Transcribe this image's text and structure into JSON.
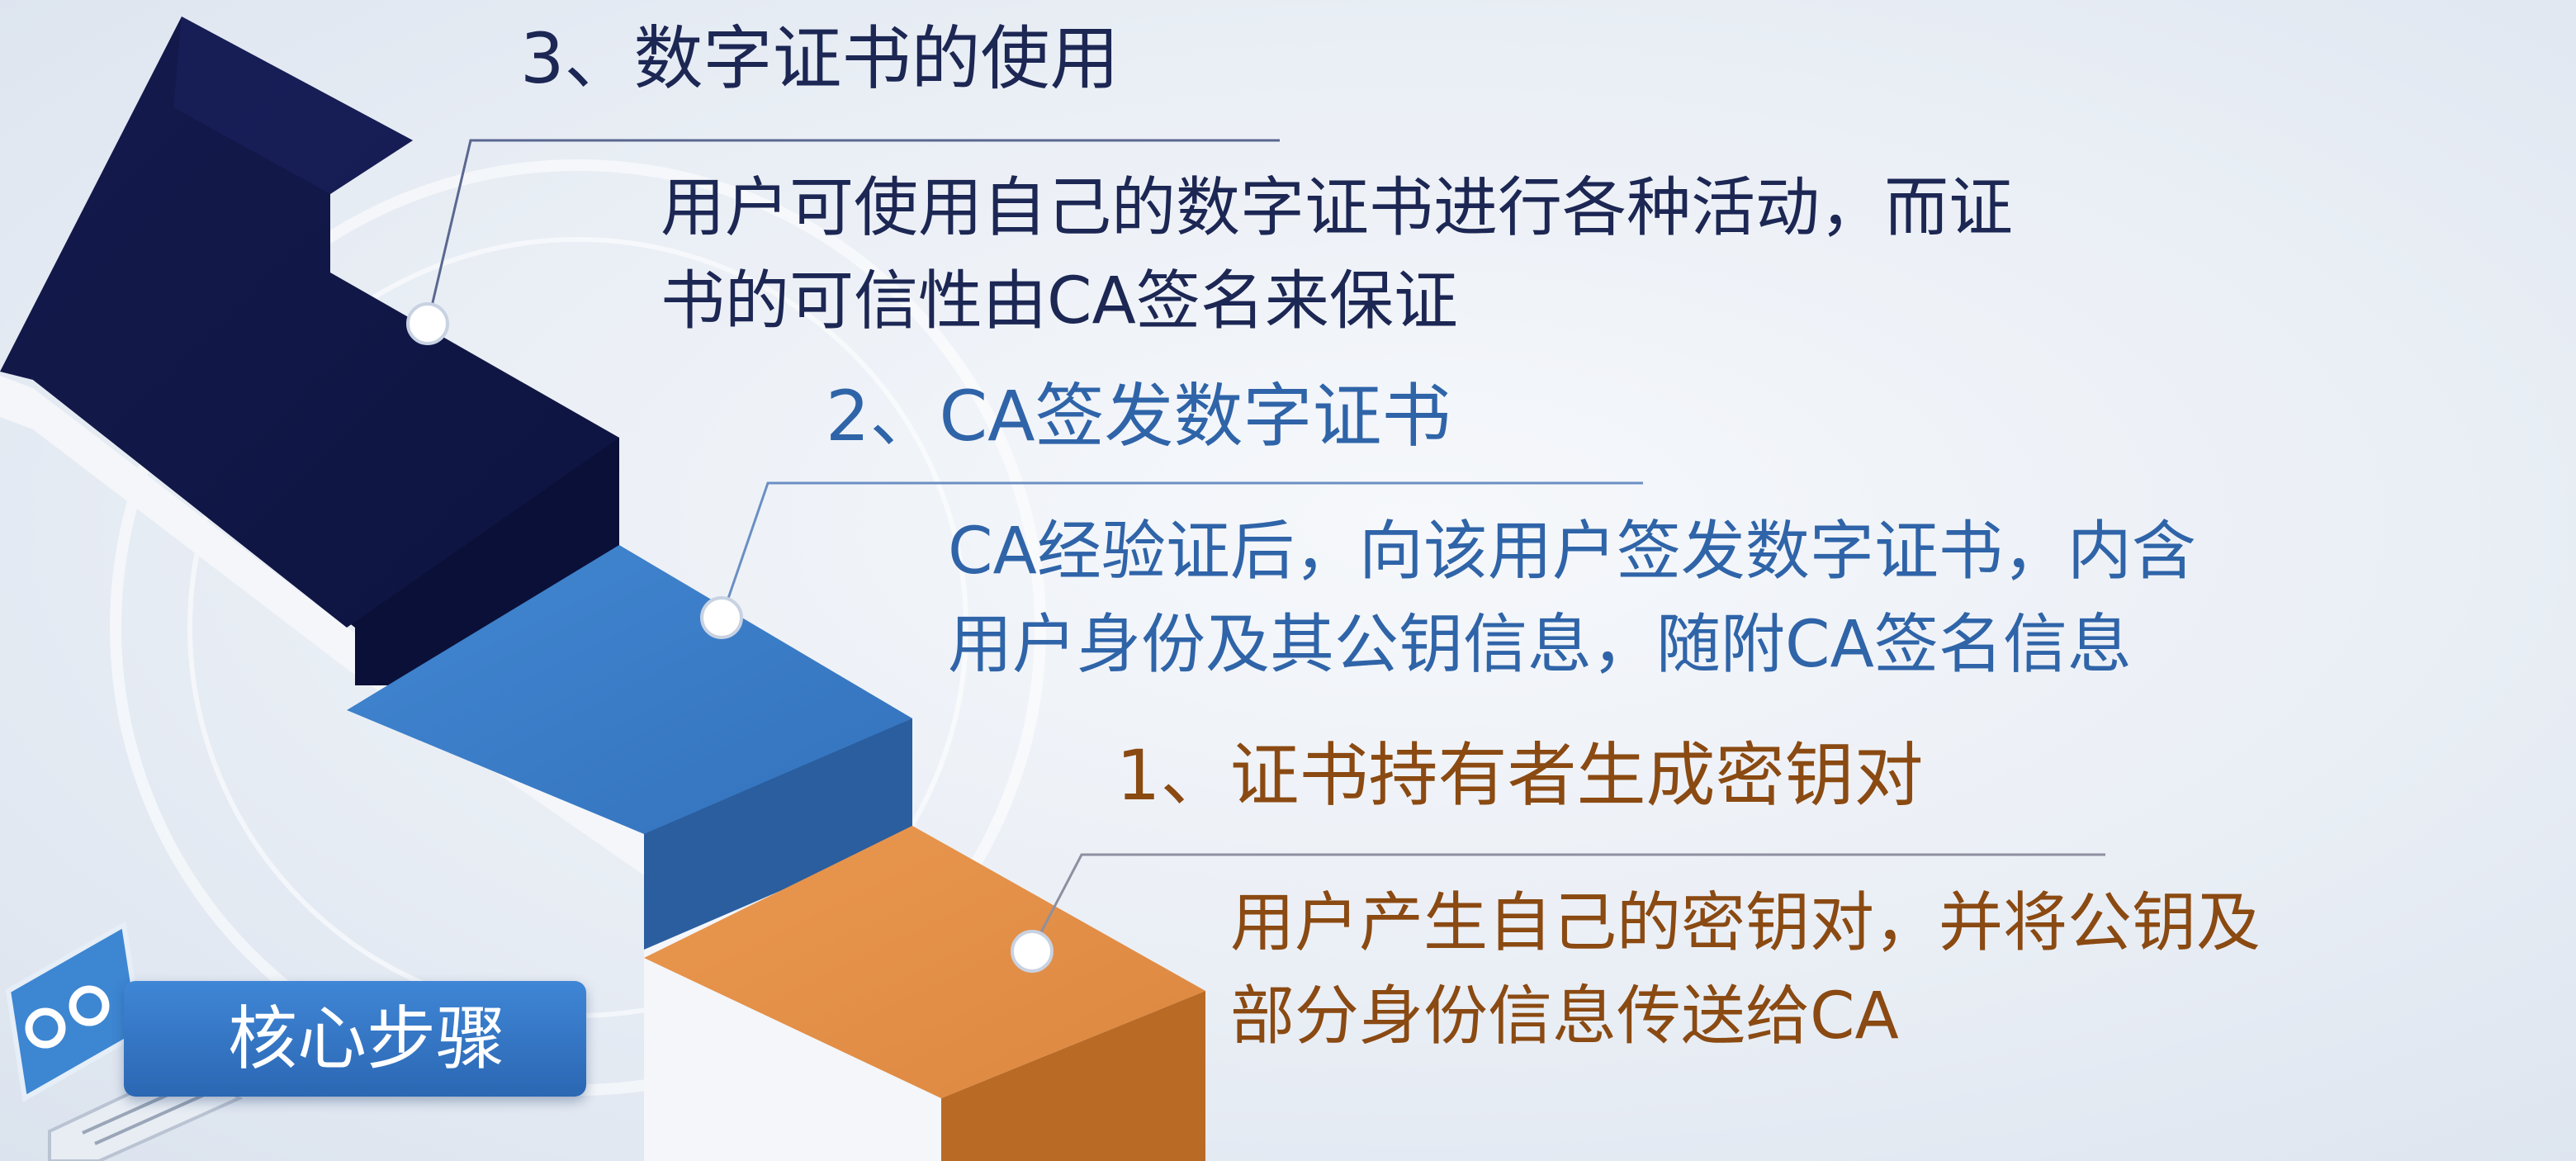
{
  "steps": [
    {
      "title": "3、数字证书的使用",
      "desc_lines": [
        "用户可使用自己的数字证书进行各种活动，而证",
        "书的可信性由CA签名来保证"
      ]
    },
    {
      "title": "2、CA签发数字证书",
      "desc_lines": [
        "CA经验证后，向该用户签发数字证书，内含",
        "用户身份及其公钥信息，随附CA签名信息"
      ]
    },
    {
      "title": "1、证书持有者生成密钥对",
      "desc_lines": [
        "用户产生自己的密钥对，并将公钥及",
        "部分身份信息传送给CA"
      ]
    }
  ],
  "badge": {
    "label": "核心步骤",
    "icon": "computer-gear-icon"
  },
  "colors": {
    "step3": "#14194a",
    "step2": "#3a7cc6",
    "step1": "#e08c45",
    "text3": "#1c2754",
    "text2": "#2f64a8",
    "text1": "#8a4a12"
  }
}
